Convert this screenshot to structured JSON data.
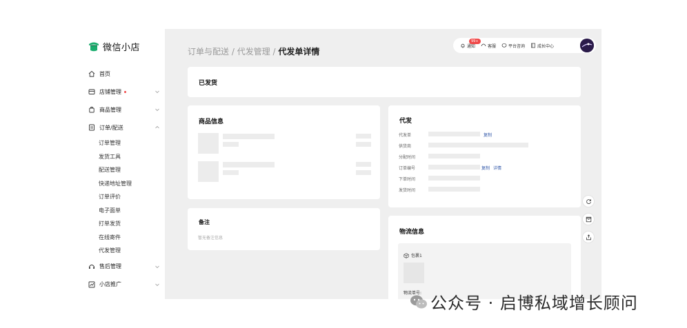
{
  "app": {
    "title": "微信小店"
  },
  "sidebar": {
    "items": [
      {
        "label": "首页",
        "has_dot": false
      },
      {
        "label": "店铺管理",
        "has_dot": true
      },
      {
        "label": "商品管理",
        "has_dot": false
      },
      {
        "label": "订单/配送",
        "has_dot": false
      }
    ],
    "order_sub_items": [
      "订单管理",
      "发货工具",
      "配送管理",
      "快递地址管理",
      "订单评价",
      "电子面单",
      "打单发货",
      "在线寄件",
      "代发管理"
    ],
    "bottom_items": [
      {
        "label": "售后管理"
      },
      {
        "label": "小店推广"
      }
    ]
  },
  "breadcrumb": {
    "part1": "订单与配送",
    "sep": " / ",
    "part2": "代发管理",
    "current": "代发单详情"
  },
  "topbar": {
    "notice_label": "通知",
    "notice_badge": "99+",
    "service_label": "客服",
    "consult_label": "平台咨询",
    "growth_label": "成长中心"
  },
  "status_card": {
    "status": "已发货"
  },
  "product_card": {
    "title": "商品信息"
  },
  "remark_card": {
    "title": "备注",
    "empty_text": "暂无备注信息"
  },
  "dropship_card": {
    "title": "代发",
    "fields": [
      "代发单",
      "供货商",
      "分配时间",
      "订单编号",
      "下单时间",
      "发货时间"
    ],
    "copy_label": "复制",
    "detail_label": "详情"
  },
  "logistics_card": {
    "title": "物流信息",
    "package_label": "包裹1",
    "waybill_label": "物流单号:"
  },
  "watermark": {
    "text": "公众号 · 启博私域增长顾问"
  },
  "colors": {
    "accent_green": "#1aad6e",
    "link_blue": "#2f56a8",
    "badge_red": "#f04848",
    "main_bg": "#efefef"
  }
}
